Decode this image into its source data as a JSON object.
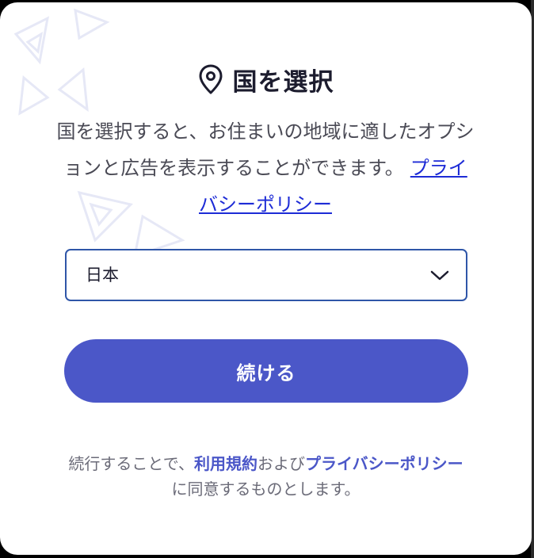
{
  "dialog": {
    "title": "国を選択",
    "description": "国を選択すると、お住まいの地域に適したオプションと広告を表示することができます。",
    "privacy_link": "プライバシーポリシー",
    "country_select": {
      "selected": "日本"
    },
    "continue_label": "続ける",
    "footer": {
      "prefix": "続行することで、",
      "terms_link": "利用規約",
      "conjunction": "および",
      "privacy_link": "プライバシーポリシー",
      "suffix": "に同意するものとします。"
    }
  },
  "colors": {
    "accent": "#4b57c8",
    "link": "#1d2bd6",
    "select_border": "#2f56a8",
    "title_text": "#1c1c2e",
    "body_text": "#4a4a55"
  },
  "icons": {
    "title_icon": "map-pin-icon",
    "select_icon": "chevron-down-icon"
  }
}
